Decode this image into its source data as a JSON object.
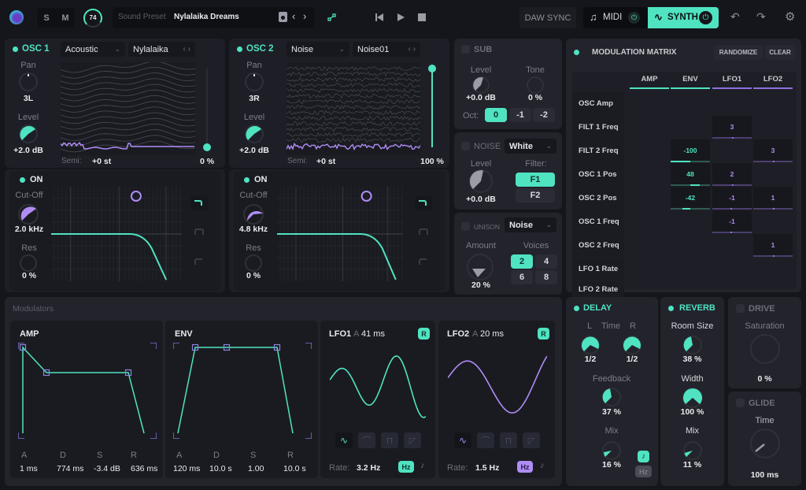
{
  "topbar": {
    "solo_label": "S",
    "mute_label": "M",
    "volume_value": "74",
    "preset_label": "Sound Preset",
    "preset_name": "Nylalaika Dreams",
    "daw_sync_label": "DAW SYNC",
    "midi_label": "MIDI",
    "synth_label": "SYNTH"
  },
  "osc1": {
    "title": "OSC 1",
    "category": "Acoustic",
    "wavetable": "Nylalaika",
    "pan_label": "Pan",
    "pan_value": "3L",
    "level_label": "Level",
    "level_value": "+2.0 dB",
    "semi_label": "Semi:",
    "semi_value": "+0 st",
    "position_value": "0 %",
    "position_fraction": 0.0
  },
  "filter1": {
    "on_label": "ON",
    "cutoff_label": "Cut-Off",
    "cutoff_value": "2.0 kHz",
    "res_label": "Res",
    "res_value": "0 %"
  },
  "osc2": {
    "title": "OSC 2",
    "category": "Noise",
    "wavetable": "Noise01",
    "pan_label": "Pan",
    "pan_value": "3R",
    "level_label": "Level",
    "level_value": "+2.0 dB",
    "semi_label": "Semi:",
    "semi_value": "+0 st",
    "position_value": "100 %",
    "position_fraction": 1.0
  },
  "filter2": {
    "on_label": "ON",
    "cutoff_label": "Cut-Off",
    "cutoff_value": "4.8 kHz",
    "res_label": "Res",
    "res_value": "0 %"
  },
  "sub": {
    "title": "SUB",
    "level_label": "Level",
    "level_value": "+0.0 dB",
    "tone_label": "Tone",
    "tone_value": "0 %",
    "oct_label": "Oct:",
    "oct_options": [
      "0",
      "-1",
      "-2"
    ],
    "oct_selected": "0"
  },
  "noise": {
    "title": "NOISE",
    "type": "White",
    "level_label": "Level",
    "level_value": "+0.0 dB",
    "filter_label": "Filter:",
    "filter_options": [
      "F1",
      "F2"
    ],
    "filter_selected": "F1"
  },
  "unison": {
    "title": "UNISON",
    "mode": "Noise",
    "amount_label": "Amount",
    "amount_value": "20 %",
    "voices_label": "Voices",
    "voices_options": [
      "2",
      "4",
      "6",
      "8"
    ],
    "voices_selected": "2"
  },
  "matrix": {
    "title": "MODULATION MATRIX",
    "randomize_label": "RANDOMIZE",
    "clear_label": "CLEAR",
    "columns": [
      "AMP",
      "ENV",
      "LFO1",
      "LFO2"
    ],
    "rows": [
      {
        "label": "OSC Amp",
        "cells": [
          "",
          "",
          "",
          ""
        ]
      },
      {
        "label": "FILT 1 Freq",
        "cells": [
          "",
          "",
          "3",
          ""
        ]
      },
      {
        "label": "FILT 2 Freq",
        "cells": [
          "",
          "-100",
          "",
          "3"
        ]
      },
      {
        "label": "OSC 1 Pos",
        "cells": [
          "",
          "48",
          "2",
          ""
        ]
      },
      {
        "label": "OSC 2 Pos",
        "cells": [
          "",
          "-42",
          "-1",
          "1"
        ]
      },
      {
        "label": "OSC 1 Freq",
        "cells": [
          "",
          "",
          "-1",
          ""
        ]
      },
      {
        "label": "OSC 2 Freq",
        "cells": [
          "",
          "",
          "",
          "1"
        ]
      },
      {
        "label": "LFO 1 Rate",
        "cells": [
          "",
          "",
          "",
          ""
        ]
      },
      {
        "label": "LFO 2 Rate",
        "cells": [
          "",
          "",
          "",
          ""
        ]
      }
    ]
  },
  "modulators": {
    "title": "Modulators",
    "amp": {
      "title": "AMP",
      "labels": [
        "A",
        "D",
        "S",
        "R"
      ],
      "values": [
        "1 ms",
        "774 ms",
        "-3.4 dB",
        "636 ms"
      ]
    },
    "env": {
      "title": "ENV",
      "labels": [
        "A",
        "D",
        "S",
        "R"
      ],
      "values": [
        "120 ms",
        "10.0 s",
        "1.00",
        "10.0 s"
      ]
    },
    "lfo1": {
      "title": "LFO1",
      "attack_label": "A",
      "attack_value": "41 ms",
      "retrigger_label": "R",
      "rate_label": "Rate:",
      "rate_value": "3.2 Hz",
      "unit_label": "Hz"
    },
    "lfo2": {
      "title": "LFO2",
      "attack_label": "A",
      "attack_value": "20 ms",
      "retrigger_label": "R",
      "rate_label": "Rate:",
      "rate_value": "1.5 Hz",
      "unit_label": "Hz"
    }
  },
  "delay": {
    "title": "DELAY",
    "l_label": "L",
    "time_label": "Time",
    "r_label": "R",
    "l_value": "1/2",
    "r_value": "1/2",
    "feedback_label": "Feedback",
    "feedback_value": "37 %",
    "mix_label": "Mix",
    "mix_value": "16 %",
    "hz_label": "Hz"
  },
  "reverb": {
    "title": "REVERB",
    "room_label": "Room Size",
    "room_value": "38 %",
    "width_label": "Width",
    "width_value": "100 %",
    "mix_label": "Mix",
    "mix_value": "11 %"
  },
  "drive": {
    "title": "DRIVE",
    "saturation_label": "Saturation",
    "saturation_value": "0 %"
  },
  "glide": {
    "title": "GLIDE",
    "time_label": "Time",
    "time_value": "100 ms"
  },
  "colors": {
    "accent": "#4fe3c1",
    "secondary": "#b08cf5",
    "background": "#15161b",
    "panel": "#22232b"
  }
}
